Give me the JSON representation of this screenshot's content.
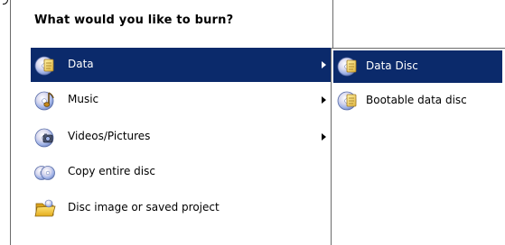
{
  "menu": {
    "title": "What would you like to burn?",
    "items": [
      {
        "label": "Data",
        "icon": "data-disc-icon",
        "has_submenu": true,
        "selected": true
      },
      {
        "label": "Music",
        "icon": "music-disc-icon",
        "has_submenu": true,
        "selected": false
      },
      {
        "label": "Videos/Pictures",
        "icon": "video-disc-icon",
        "has_submenu": true,
        "selected": false
      },
      {
        "label": "Copy entire disc",
        "icon": "copy-disc-icon",
        "has_submenu": false,
        "selected": false
      },
      {
        "label": "Disc image or saved project",
        "icon": "folder-icon",
        "has_submenu": false,
        "selected": false
      }
    ]
  },
  "submenu": {
    "items": [
      {
        "label": "Data Disc",
        "icon": "data-disc-icon",
        "selected": true
      },
      {
        "label": "Bootable data disc",
        "icon": "bootable-disc-icon",
        "selected": false
      }
    ]
  },
  "colors": {
    "selection": "#0b2a6b",
    "selection_text": "#ffffff",
    "border": "#6b6b6b"
  }
}
